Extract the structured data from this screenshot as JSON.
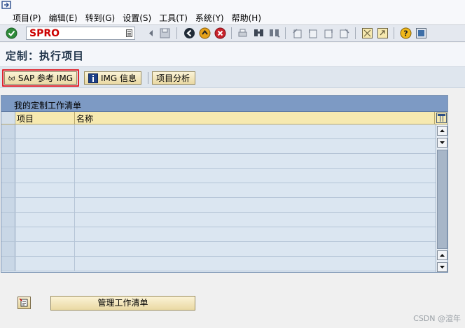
{
  "menu": {
    "items": [
      "项目(P)",
      "编辑(E)",
      "转到(G)",
      "设置(S)",
      "工具(T)",
      "系统(Y)",
      "帮助(H)"
    ]
  },
  "toolbar": {
    "command_value": "SPRO",
    "icons": [
      "enter-icon",
      "save-icon",
      "back-icon",
      "exit-icon",
      "cancel-icon",
      "print-icon",
      "find-icon",
      "find-next-icon",
      "first-page-icon",
      "prev-page-icon",
      "next-page-icon",
      "last-page-icon",
      "new-session-icon",
      "shortcut-icon",
      "help-icon",
      "layout-icon"
    ]
  },
  "title": "定制：执行项目",
  "app_toolbar": {
    "sap_img_label": "SAP 参考 IMG",
    "img_info_label": "IMG 信息",
    "project_analysis_label": "项目分析"
  },
  "worklist": {
    "title": "我的定制工作清单",
    "columns": [
      "项目",
      "名称"
    ],
    "rows": [
      {
        "project": "",
        "name": ""
      },
      {
        "project": "",
        "name": ""
      },
      {
        "project": "",
        "name": ""
      },
      {
        "project": "",
        "name": ""
      },
      {
        "project": "",
        "name": ""
      },
      {
        "project": "",
        "name": ""
      },
      {
        "project": "",
        "name": ""
      },
      {
        "project": "",
        "name": ""
      },
      {
        "project": "",
        "name": ""
      },
      {
        "project": "",
        "name": ""
      }
    ]
  },
  "bottom": {
    "manage_label": "管理工作清单"
  },
  "watermark": "CSDN @渲年",
  "colors": {
    "highlight": "#e0262e",
    "header_bg": "#7d9ac4",
    "button_bg": "#ead9a3"
  }
}
